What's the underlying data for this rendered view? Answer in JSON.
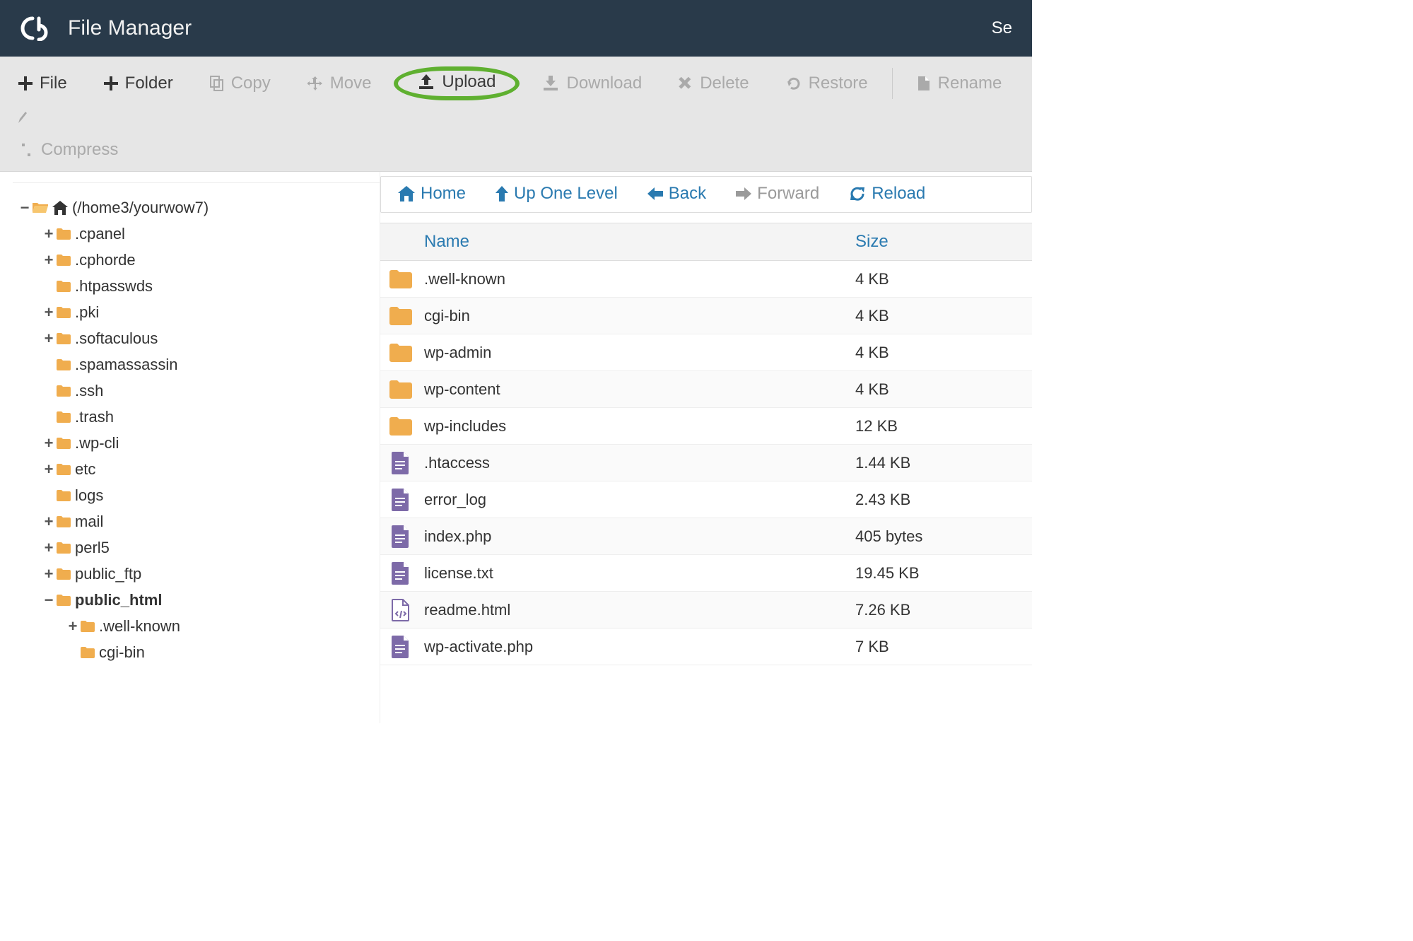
{
  "header": {
    "title": "File Manager",
    "right_label": "Se"
  },
  "toolbar": {
    "file": "File",
    "folder": "Folder",
    "copy": "Copy",
    "move": "Move",
    "upload": "Upload",
    "download": "Download",
    "delete": "Delete",
    "restore": "Restore",
    "rename": "Rename",
    "compress": "Compress"
  },
  "tree": {
    "root_label": "(/home3/yourwow7)",
    "items": [
      {
        "toggle": "+",
        "label": ".cpanel",
        "level": 1
      },
      {
        "toggle": "+",
        "label": ".cphorde",
        "level": 1
      },
      {
        "toggle": "",
        "label": ".htpasswds",
        "level": 1
      },
      {
        "toggle": "+",
        "label": ".pki",
        "level": 1
      },
      {
        "toggle": "+",
        "label": ".softaculous",
        "level": 1
      },
      {
        "toggle": "",
        "label": ".spamassassin",
        "level": 1
      },
      {
        "toggle": "",
        "label": ".ssh",
        "level": 1
      },
      {
        "toggle": "",
        "label": ".trash",
        "level": 1
      },
      {
        "toggle": "+",
        "label": ".wp-cli",
        "level": 1
      },
      {
        "toggle": "+",
        "label": "etc",
        "level": 1
      },
      {
        "toggle": "",
        "label": "logs",
        "level": 1
      },
      {
        "toggle": "+",
        "label": "mail",
        "level": 1
      },
      {
        "toggle": "+",
        "label": "perl5",
        "level": 1
      },
      {
        "toggle": "+",
        "label": "public_ftp",
        "level": 1
      },
      {
        "toggle": "−",
        "label": "public_html",
        "level": 1,
        "bold": true
      },
      {
        "toggle": "+",
        "label": ".well-known",
        "level": 2
      },
      {
        "toggle": "",
        "label": "cgi-bin",
        "level": 2
      }
    ]
  },
  "nav": {
    "home": "Home",
    "up": "Up One Level",
    "back": "Back",
    "forward": "Forward",
    "reload": "Reload"
  },
  "table": {
    "columns": {
      "name": "Name",
      "size": "Size"
    },
    "rows": [
      {
        "type": "folder",
        "name": ".well-known",
        "size": "4 KB"
      },
      {
        "type": "folder",
        "name": "cgi-bin",
        "size": "4 KB"
      },
      {
        "type": "folder",
        "name": "wp-admin",
        "size": "4 KB"
      },
      {
        "type": "folder",
        "name": "wp-content",
        "size": "4 KB"
      },
      {
        "type": "folder",
        "name": "wp-includes",
        "size": "12 KB"
      },
      {
        "type": "file",
        "name": ".htaccess",
        "size": "1.44 KB"
      },
      {
        "type": "file",
        "name": "error_log",
        "size": "2.43 KB"
      },
      {
        "type": "file",
        "name": "index.php",
        "size": "405 bytes"
      },
      {
        "type": "file",
        "name": "license.txt",
        "size": "19.45 KB"
      },
      {
        "type": "html",
        "name": "readme.html",
        "size": "7.26 KB"
      },
      {
        "type": "file",
        "name": "wp-activate.php",
        "size": "7 KB"
      }
    ]
  }
}
